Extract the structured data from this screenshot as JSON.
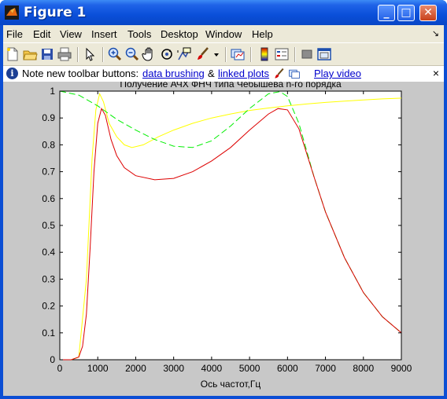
{
  "window": {
    "title": "Figure 1"
  },
  "titlebar_buttons": {
    "minimize": "_",
    "maximize": "□",
    "close": "✕"
  },
  "menus": [
    "File",
    "Edit",
    "View",
    "Insert",
    "Tools",
    "Desktop",
    "Window",
    "Help"
  ],
  "menu_corner": "↘",
  "toolbar_icons": [
    "new-figure-icon",
    "open-file-icon",
    "save-icon",
    "print-icon",
    "pointer-arrow-icon",
    "zoom-in-icon",
    "zoom-out-icon",
    "pan-hand-icon",
    "rotate-3d-icon",
    "data-cursor-icon",
    "brush-icon",
    "brush-dropdown-icon",
    "link-plot-icon",
    "colorbar-icon",
    "legend-icon",
    "hide-plot-tools-icon",
    "show-plot-tools-icon"
  ],
  "infobar": {
    "prefix": "Note new toolbar buttons:",
    "link1": "data brushing",
    "amp": "&",
    "link2": "linked plots",
    "video": "Play video",
    "close": "×"
  },
  "chart_data": {
    "type": "line",
    "title": "Получение АЧХ ФНЧ типа Чебышева n-го порядка",
    "xlabel": "Ось частот,Гц",
    "ylabel": "",
    "xlim": [
      0,
      9000
    ],
    "ylim": [
      0,
      1
    ],
    "xticks": [
      0,
      1000,
      2000,
      3000,
      4000,
      5000,
      6000,
      7000,
      8000,
      9000
    ],
    "yticks": [
      0,
      0.1,
      0.2,
      0.3,
      0.4,
      0.5,
      0.6,
      0.7,
      0.8,
      0.9,
      1
    ],
    "ytick_labels": [
      "0",
      "0.1",
      "0.2",
      "0.3",
      "0.4",
      "0.5",
      "0.6",
      "0.7",
      "0.8",
      "0.9",
      "1"
    ],
    "grid": false,
    "series": [
      {
        "color": "#ffff00",
        "style": "solid",
        "x": [
          0,
          300,
          500,
          700,
          850,
          950,
          1050,
          1150,
          1300,
          1500,
          1700,
          1900,
          2200,
          2600,
          3000,
          3500,
          4000,
          4500,
          5000,
          5500,
          6000,
          6500,
          7000,
          7500,
          8000,
          8500,
          9000
        ],
        "y": [
          0,
          0,
          0.01,
          0.3,
          0.75,
          0.93,
          0.99,
          0.96,
          0.88,
          0.83,
          0.8,
          0.79,
          0.8,
          0.83,
          0.855,
          0.88,
          0.9,
          0.915,
          0.928,
          0.937,
          0.945,
          0.952,
          0.958,
          0.963,
          0.967,
          0.971,
          0.974
        ]
      },
      {
        "color": "#00ee00",
        "style": "dashed",
        "x": [
          0,
          500,
          1000,
          1500,
          2000,
          2500,
          3000,
          3500,
          4000,
          4500,
          5000,
          5500,
          5800,
          6000,
          6300,
          6700,
          7000,
          7500,
          8000,
          8500,
          9000
        ],
        "y": [
          1,
          0.985,
          0.945,
          0.895,
          0.855,
          0.82,
          0.795,
          0.79,
          0.815,
          0.87,
          0.935,
          0.99,
          0.998,
          0.98,
          0.88,
          0.68,
          0.55,
          0.38,
          0.25,
          0.16,
          0.1
        ]
      },
      {
        "color": "#dd0000",
        "style": "solid",
        "x": [
          0,
          300,
          500,
          600,
          700,
          800,
          900,
          1000,
          1100,
          1200,
          1350,
          1500,
          1700,
          2000,
          2500,
          3000,
          3500,
          4000,
          4500,
          5000,
          5500,
          5750,
          6000,
          6300,
          6700,
          7000,
          7500,
          8000,
          8500,
          9000
        ],
        "y": [
          0,
          0,
          0.01,
          0.05,
          0.17,
          0.42,
          0.7,
          0.88,
          0.935,
          0.91,
          0.82,
          0.76,
          0.715,
          0.685,
          0.67,
          0.675,
          0.7,
          0.74,
          0.79,
          0.855,
          0.915,
          0.935,
          0.93,
          0.86,
          0.68,
          0.55,
          0.38,
          0.25,
          0.16,
          0.1
        ]
      }
    ]
  }
}
